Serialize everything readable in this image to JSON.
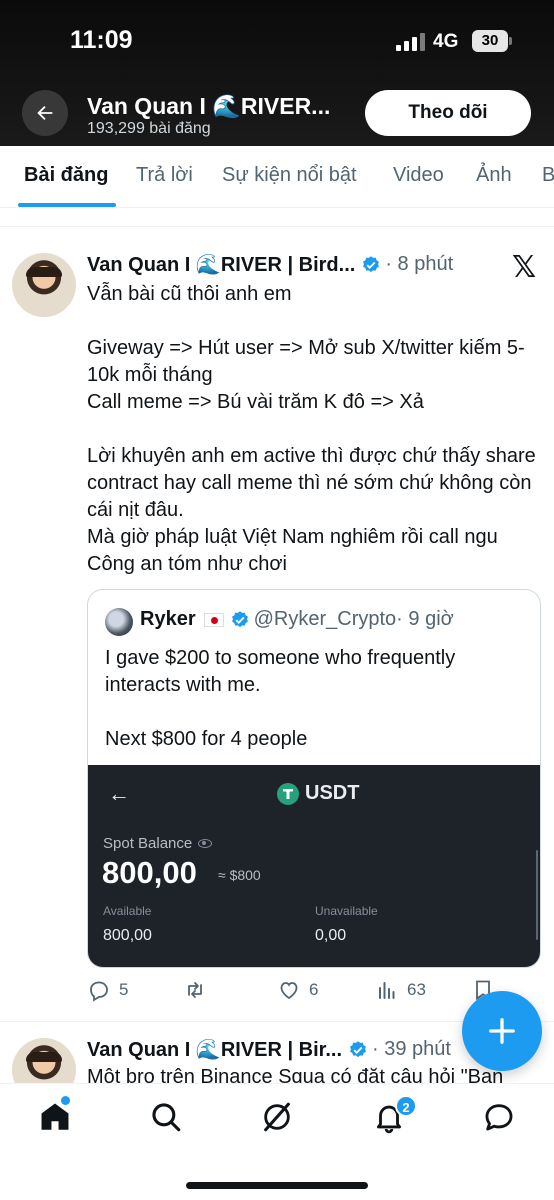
{
  "status_bar": {
    "time": "11:09",
    "network": "4G",
    "battery": "30"
  },
  "header": {
    "profile_name": "Van Quan I 🌊RIVER...",
    "post_count": "193,299 bài đăng",
    "follow_label": "Theo dõi"
  },
  "tabs": [
    {
      "label": "Bài đăng"
    },
    {
      "label": "Trả lời"
    },
    {
      "label": "Sự kiện nổi bật"
    },
    {
      "label": "Video"
    },
    {
      "label": "Ảnh"
    },
    {
      "label": "B"
    }
  ],
  "tweet": {
    "author": "Van Quan I 🌊RIVER | Bird...",
    "time": "· 8 phút",
    "lines": [
      "Vẫn bài cũ thôi anh em",
      "",
      "Giveway => Hút user => Mở sub X/twitter kiếm 5-10k mỗi tháng",
      "Call meme => Bú vài trăm K đô => Xả",
      "",
      "Lời khuyên anh em active thì được chứ thấy share contract hay call meme thì né sớm chứ không còn cái nịt đâu.",
      "Mà giờ pháp luật Việt Nam nghiêm rồi call ngu Công an tóm như chơi"
    ],
    "quote": {
      "author": "Ryker",
      "handle": "@Ryker_Crypto",
      "time": "· 9 giờ",
      "lines": [
        "I gave $200 to someone who frequently interacts with me.",
        "",
        "Next $800 for 4 people"
      ],
      "wallet": {
        "token": "USDT",
        "spot_label": "Spot Balance",
        "amount": "800,00",
        "usd": "≈ $800",
        "available_label": "Available",
        "available_value": "800,00",
        "unavailable_label": "Unavailable",
        "unavailable_value": "0,00"
      }
    },
    "actions": {
      "replies": "5",
      "reposts": "",
      "likes": "6",
      "views": "63"
    }
  },
  "tweet2": {
    "author": "Van Quan I 🌊RIVER | Bir...",
    "time": "· 39 phút",
    "text": "Một bro trên Binance Squa có đặt câu hỏi \"Bạn"
  },
  "bottom_nav": {
    "notifications_badge": "2"
  },
  "colors": {
    "accent": "#1d9bf0",
    "wallet_bg": "#1e2329",
    "header_bg": "#111111"
  }
}
